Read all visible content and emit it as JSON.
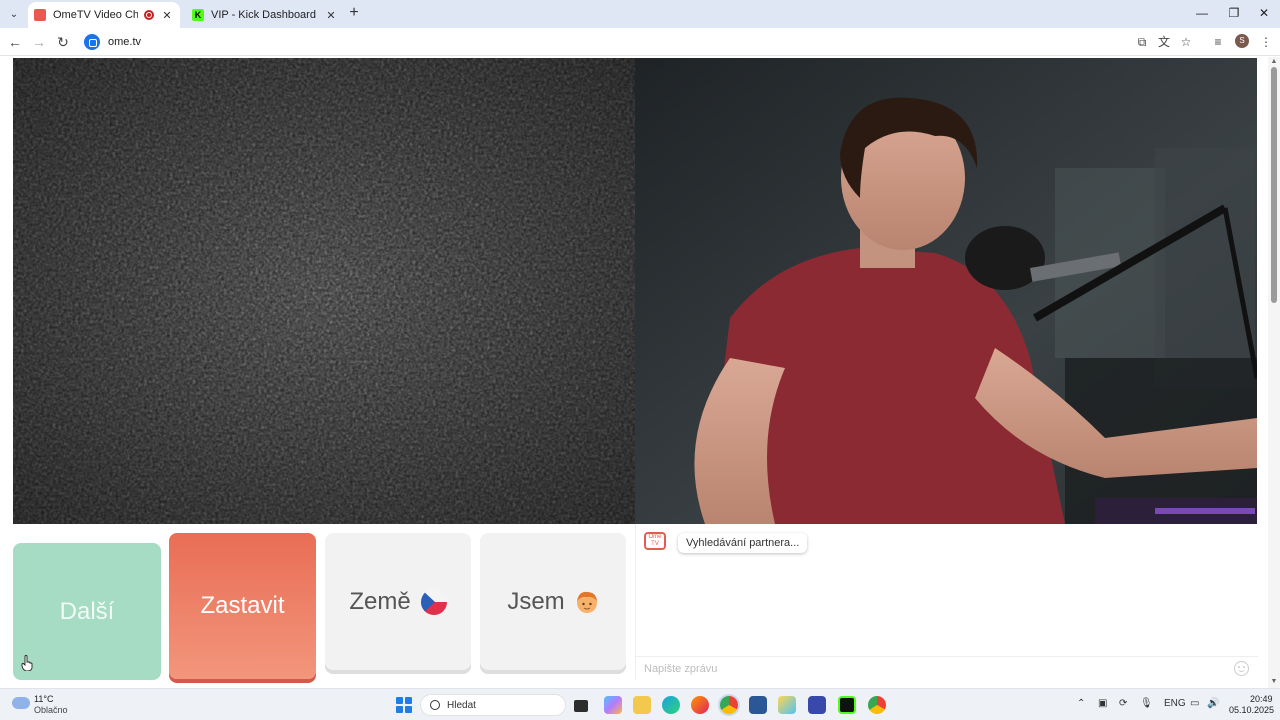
{
  "browser": {
    "tabs": [
      {
        "title": "OmeTV Video Chat — Ome",
        "favicon": "ometv-logo-icon",
        "recording": true,
        "active": true
      },
      {
        "title": "VIP - Kick Dashboard",
        "favicon": "kick-logo-icon",
        "active": false
      }
    ],
    "url": "ome.tv",
    "profile_initial": "S",
    "new_tab_symbol": "+",
    "window_controls": {
      "minimize": "—",
      "restore": "❐",
      "close": "✕"
    }
  },
  "controls": {
    "next_label": "Další",
    "stop_label": "Zastavit",
    "country_label": "Země",
    "country_flag": "czech-flag-icon",
    "gender_label": "Jsem",
    "gender_icon": "boy-face-icon",
    "colors": {
      "next": "#a6dbc4",
      "stop": "#e96d55",
      "neutral": "#f2f2f2"
    }
  },
  "chat": {
    "logo_text": "Ome TV",
    "status_message": "Vyhledávání partnera...",
    "input_placeholder": "Napište zprávu"
  },
  "taskbar": {
    "weather_temp": "11°C",
    "weather_desc": "Oblačno",
    "search_placeholder": "Hledat",
    "language": "ENG",
    "time": "20:49",
    "date": "05.10.2025"
  }
}
